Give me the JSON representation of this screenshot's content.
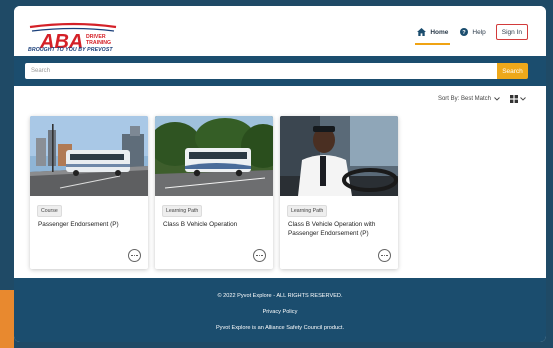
{
  "brand": {
    "logo_main": "ABA",
    "logo_side_1": "DRIVER",
    "logo_side_2": "TRAINING",
    "tagline": "BROUGHT TO YOU BY PREVOST",
    "primary_color": "#1b4d6e",
    "accent_color": "#eea81a",
    "logo_red": "#d42027",
    "logo_blue": "#1a3f7a"
  },
  "nav": {
    "home": "Home",
    "help": "Help",
    "sign_in": "Sign In"
  },
  "search": {
    "placeholder": "Search",
    "button": "Search"
  },
  "sort": {
    "label": "Sort By: Best Match"
  },
  "cards": [
    {
      "type": "Course",
      "title": "Passenger Endorsement (P)",
      "image": "coach-bus-city-street"
    },
    {
      "type": "Learning Path",
      "title": "Class B Vehicle Operation",
      "image": "coach-bus-tree-road"
    },
    {
      "type": "Learning Path",
      "title": "Class B Vehicle Operation with Passenger Endorsement (P)",
      "image": "bus-driver-portrait"
    }
  ],
  "footer": {
    "copyright": "© 2022 Pyvot Explore - ALL RIGHTS RESERVED.",
    "privacy": "Privacy Policy",
    "about": "Pyvot Explore is an Alliance Safety Council product."
  }
}
